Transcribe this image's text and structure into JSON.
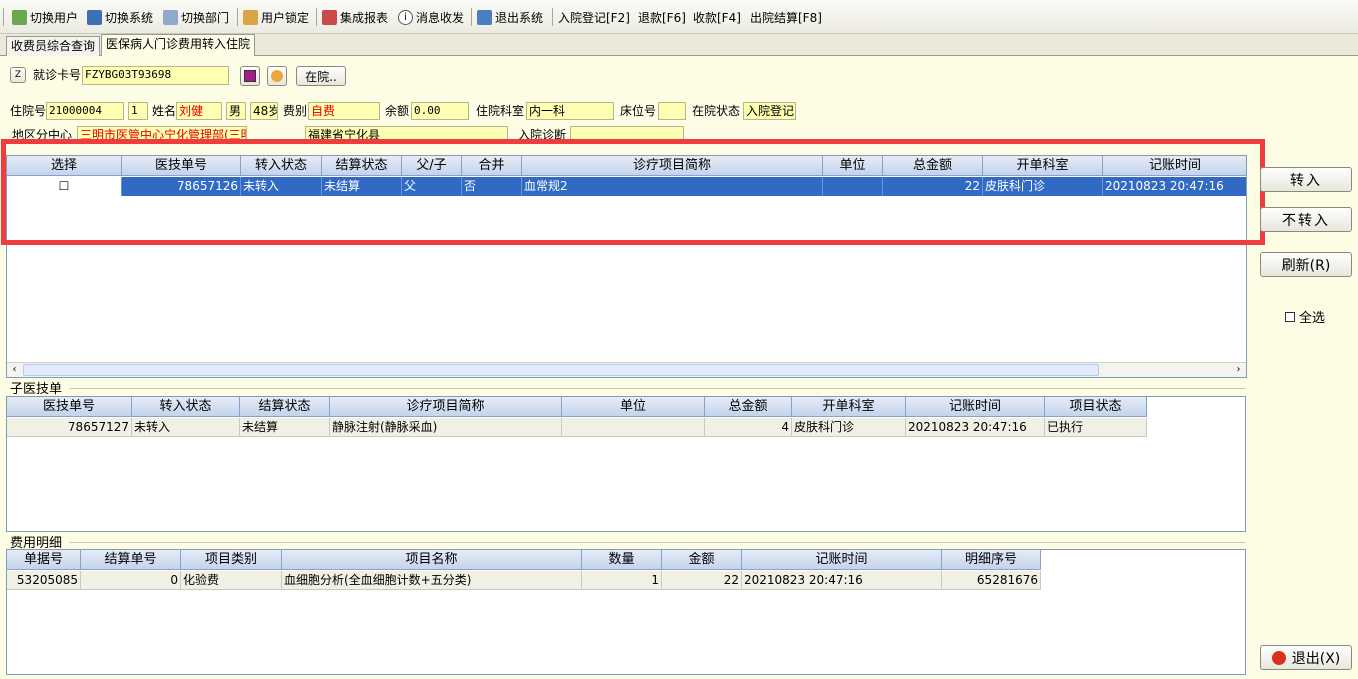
{
  "toolbar": {
    "switch_user": "切换用户",
    "switch_system": "切换系统",
    "switch_dept": "切换部门",
    "user_lock": "用户锁定",
    "report": "集成报表",
    "messages": "消息收发",
    "exit_system": "退出系统",
    "admit": "入院登记[F2]",
    "refund": "退款[F6]",
    "charge": "收款[F4]",
    "discharge": "出院结算[F8]"
  },
  "tabs": [
    "收费员综合查询",
    "医保病人门诊费用转入住院"
  ],
  "form": {
    "card_btn": "Z",
    "card_label": "就诊卡号",
    "card_value": "FZYBG03T93698",
    "in_hospital_btn": "在院..",
    "inpatient_no_label": "住院号",
    "inpatient_no": "21000004",
    "visit_count": "1",
    "name_label": "姓名",
    "name": "刘健",
    "gender": "男",
    "age": "48岁",
    "fee_type_label": "费别",
    "fee_type": "自费",
    "balance_label": "余额",
    "balance": "0.00",
    "dept_label": "住院科室",
    "dept": "内一科",
    "bed_label": "床位号",
    "bed": "",
    "status_label": "在院状态",
    "status": "入院登记",
    "region_label": "地区分中心",
    "region": "三明市医管中心宁化管理部(三明",
    "address": "福建省宁化县",
    "diagnosis_label": "入院诊断",
    "diagnosis": ""
  },
  "main_grid": {
    "columns": [
      "选择",
      "医技单号",
      "转入状态",
      "结算状态",
      "父/子",
      "合并",
      "诊疗项目简称",
      "单位",
      "总金额",
      "开单科室",
      "记账时间"
    ],
    "rows": [
      {
        "select": "☐",
        "order_no": "78657126",
        "transfer": "未转入",
        "settle": "未结算",
        "parent": "父",
        "merge": "否",
        "item": "血常规2",
        "unit": "",
        "amount": "22",
        "dept": "皮肤科门诊",
        "time": "20210823 20:47:16"
      }
    ]
  },
  "right_buttons": {
    "transfer": "转入",
    "no_transfer": "不转入",
    "refresh": "刷新(R)",
    "select_all": "全选",
    "exit": "退出(X)"
  },
  "sub_section": {
    "title": "子医技单",
    "columns": [
      "医技单号",
      "转入状态",
      "结算状态",
      "诊疗项目简称",
      "单位",
      "总金额",
      "开单科室",
      "记账时间",
      "项目状态"
    ],
    "rows": [
      {
        "order_no": "78657127",
        "transfer": "未转入",
        "settle": "未结算",
        "item": "静脉注射(静脉采血)",
        "unit": "",
        "amount": "4",
        "dept": "皮肤科门诊",
        "time": "20210823 20:47:16",
        "status": "已执行"
      }
    ]
  },
  "fee_section": {
    "title": "费用明细",
    "columns": [
      "单据号",
      "结算单号",
      "项目类别",
      "项目名称",
      "数量",
      "金额",
      "记账时间",
      "明细序号"
    ],
    "rows": [
      {
        "doc_no": "53205085",
        "settle_no": "0",
        "category": "化验费",
        "name": "血细胞分析(全血细胞计数+五分类)",
        "qty": "1",
        "amount": "22",
        "time": "20210823 20:47:16",
        "seq": "65281676"
      }
    ]
  },
  "colors": {
    "highlight_box": "#f03c3c",
    "selected_row": "#316ac5",
    "field_bg": "#ffffb3",
    "panel_bg": "#fdfce5"
  }
}
